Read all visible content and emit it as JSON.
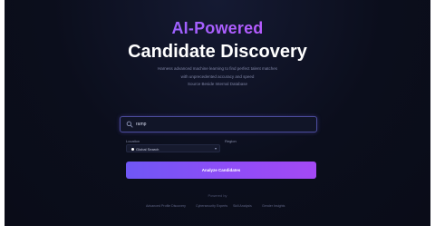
{
  "hero": {
    "title_line1": "AI-Powered",
    "title_line2": "Candidate Discovery",
    "subtitle_lines": [
      "Harness advanced machine learning to find perfect talent matches",
      "with unprecedented accuracy and speed",
      "Source Beside Internal Database"
    ]
  },
  "search": {
    "value": "ramp",
    "icon": "search-icon"
  },
  "filters": {
    "location_label": "Location",
    "location_value": "Global Search",
    "region_label": "Region"
  },
  "actions": {
    "analyze_label": "Analyze Candidates"
  },
  "footer": {
    "powered_label": "Powered by",
    "features": [
      "Advanced Profile Discovery",
      "Cybersecurity Experts",
      "Skill Analysis",
      "Gender Insights"
    ]
  },
  "colors": {
    "background": "#0b0e1c",
    "accent_start": "#6f57f6",
    "accent_end": "#a449f4",
    "title_gradient_start": "#6f6bff",
    "title_gradient_end": "#d15bff",
    "search_border": "#4b4c9c"
  }
}
